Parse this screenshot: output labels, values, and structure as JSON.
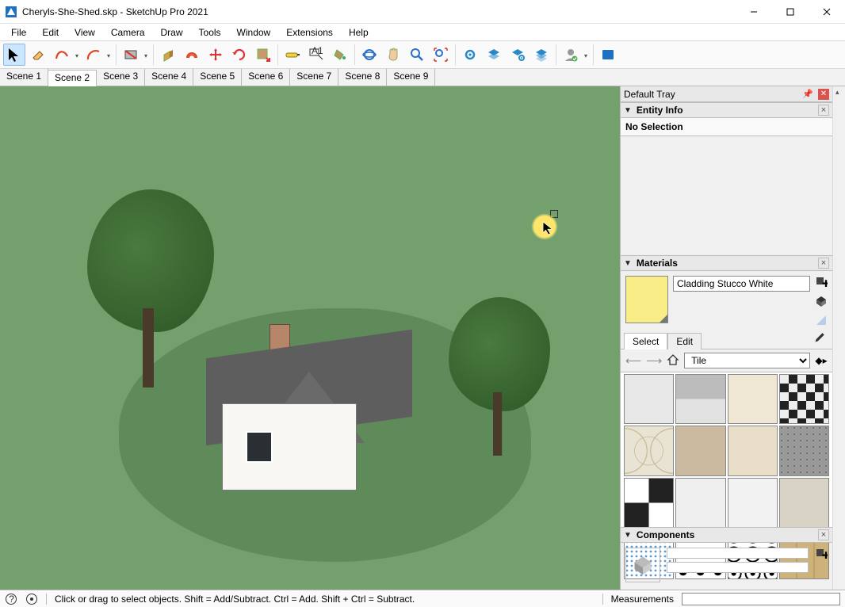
{
  "window": {
    "title": "Cheryls-She-Shed.skp - SketchUp Pro 2021"
  },
  "menu": {
    "items": [
      "File",
      "Edit",
      "View",
      "Camera",
      "Draw",
      "Tools",
      "Window",
      "Extensions",
      "Help"
    ]
  },
  "toolbar": {
    "buttons": [
      {
        "name": "select-tool",
        "active": true,
        "dropdown": false
      },
      {
        "name": "eraser-tool",
        "dropdown": false
      },
      {
        "name": "freehand-arc-tool",
        "dropdown": true
      },
      {
        "name": "arc-tool",
        "dropdown": true
      },
      {
        "name": "__sep"
      },
      {
        "name": "rectangle-tool",
        "dropdown": true
      },
      {
        "name": "__sep"
      },
      {
        "name": "push-pull-tool",
        "dropdown": false
      },
      {
        "name": "offset-tool",
        "dropdown": false
      },
      {
        "name": "move-tool",
        "dropdown": false
      },
      {
        "name": "rotate-tool",
        "dropdown": false
      },
      {
        "name": "scale-tool",
        "dropdown": false
      },
      {
        "name": "__sep"
      },
      {
        "name": "tape-measure-tool",
        "dropdown": false
      },
      {
        "name": "text-label-tool",
        "dropdown": false
      },
      {
        "name": "paint-bucket-tool",
        "dropdown": false
      },
      {
        "name": "__sep"
      },
      {
        "name": "orbit-tool",
        "dropdown": false
      },
      {
        "name": "pan-tool",
        "dropdown": false
      },
      {
        "name": "zoom-tool",
        "dropdown": false
      },
      {
        "name": "zoom-extents-tool",
        "dropdown": false
      },
      {
        "name": "__sep"
      },
      {
        "name": "warehouse-gear-tool",
        "dropdown": false
      },
      {
        "name": "warehouse-stack-tool",
        "dropdown": false
      },
      {
        "name": "extension-warehouse-tool",
        "dropdown": false
      },
      {
        "name": "layers-panel-tool",
        "dropdown": false
      },
      {
        "name": "__sep"
      },
      {
        "name": "account-tool",
        "dropdown": true
      },
      {
        "name": "__sep"
      },
      {
        "name": "blue-panel-tool",
        "dropdown": false
      }
    ]
  },
  "scenes": {
    "tabs": [
      "Scene 1",
      "Scene 2",
      "Scene 3",
      "Scene 4",
      "Scene 5",
      "Scene 6",
      "Scene 7",
      "Scene 8",
      "Scene 9"
    ],
    "active_index": 1
  },
  "tray": {
    "title": "Default Tray",
    "entity_info": {
      "title": "Entity Info",
      "body": "No Selection"
    },
    "materials": {
      "title": "Materials",
      "current_name": "Cladding Stucco White",
      "tabs": {
        "select": "Select",
        "edit": "Edit",
        "active": "select"
      },
      "category": "Tile",
      "tiles_count": 16
    },
    "components": {
      "title": "Components"
    }
  },
  "status": {
    "hint": "Click or drag to select objects. Shift = Add/Subtract. Ctrl = Add. Shift + Ctrl = Subtract.",
    "measurements_label": "Measurements",
    "measurements_value": ""
  }
}
